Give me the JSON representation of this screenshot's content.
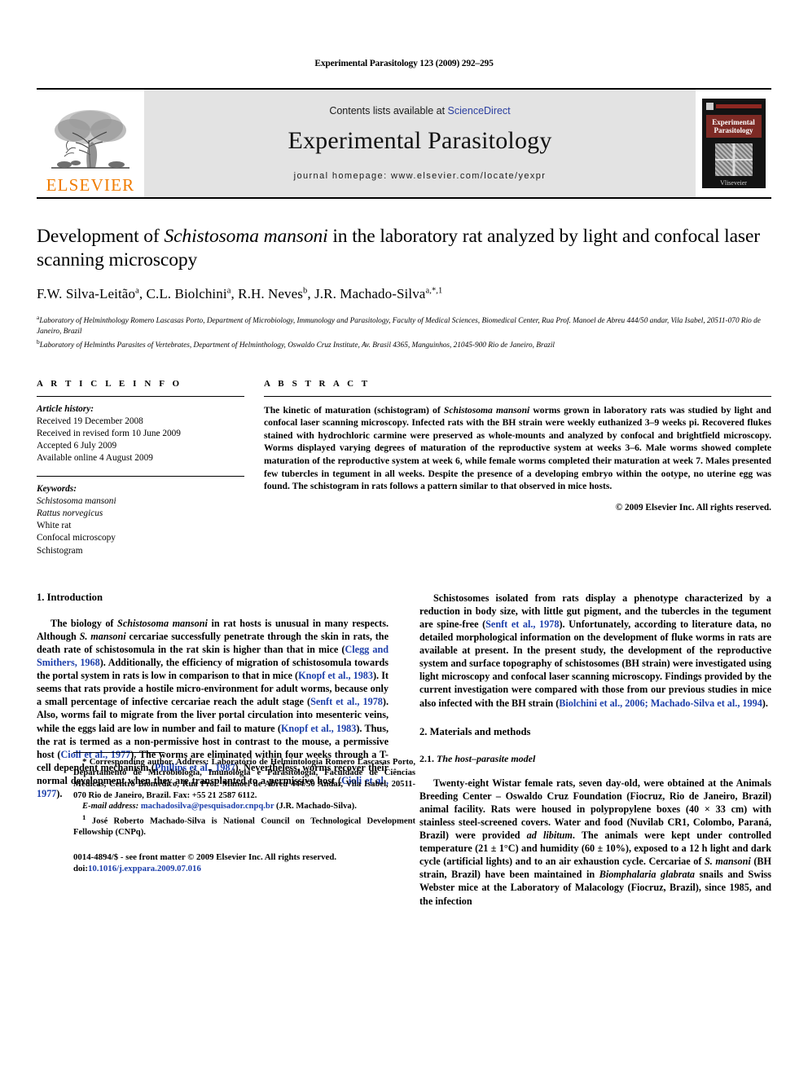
{
  "running_head": "Experimental Parasitology 123 (2009) 292–295",
  "masthead": {
    "elsevier_wordmark": "ELSEVIER",
    "contents_prefix": "Contents lists available at ",
    "sciencedirect": "ScienceDirect",
    "journal_title": "Experimental Parasitology",
    "homepage": "journal homepage: www.elsevier.com/locate/yexpr",
    "cover_title_line1": "Experimental",
    "cover_title_line2": "Parasitology",
    "cover_publisher": "Vliseveier",
    "banner_bg": "#e3e3e3",
    "elsevier_orange": "#F07C00",
    "link_blue": "#2b3fa0"
  },
  "article": {
    "title_part1": "Development of ",
    "title_italic": "Schistosoma mansoni",
    "title_part2": " in the laboratory rat analyzed by light and confocal laser scanning microscopy",
    "authors": "F.W. Silva-Leitão a, C.L. Biolchini a, R.H. Neves b, J.R. Machado-Silva a,*,1",
    "authors_parts": [
      {
        "name": "F.W. Silva-Leitão",
        "sup": "a"
      },
      {
        "name": "C.L. Biolchini",
        "sup": "a"
      },
      {
        "name": "R.H. Neves",
        "sup": "b"
      },
      {
        "name": "J.R. Machado-Silva",
        "sup": "a,*,1"
      }
    ],
    "affiliation_a": "Laboratory of Helminthology Romero Lascasas Porto, Department of Microbiology, Immunology and Parasitology, Faculty of Medical Sciences, Biomedical Center, Rua Prof. Manoel de Abreu 444/50 andar, Vila Isabel, 20511-070 Rio de Janeiro, Brazil",
    "affiliation_b": "Laboratory of Helminths Parasites of Vertebrates, Department of Helminthology, Oswaldo Cruz Institute, Av. Brasil 4365, Manguinhos, 21045-900 Rio de Janeiro, Brazil",
    "affiliation_a_sup": "a",
    "affiliation_b_sup": "b"
  },
  "article_info": {
    "heading": "A R T I C L E  I N F O",
    "history_label": "Article history:",
    "history": [
      "Received 19 December 2008",
      "Received in revised form 10 June 2009",
      "Accepted 6 July 2009",
      "Available online 4 August 2009"
    ],
    "keywords_label": "Keywords:",
    "keywords": [
      "Schistosoma mansoni",
      "Rattus norvegicus",
      "White rat",
      "Confocal microscopy",
      "Schistogram"
    ],
    "keywords_italic_count": 2
  },
  "abstract": {
    "heading": "A B S T R A C T",
    "text_1": "The kinetic of maturation (schistogram) of ",
    "text_italic_1": "Schistosoma mansoni",
    "text_2": " worms grown in laboratory rats was studied by light and confocal laser scanning microscopy. Infected rats with the BH strain were weekly euthanized 3–9 weeks pi. Recovered flukes stained with hydrochloric carmine were preserved as whole-mounts and analyzed by confocal and brightfield microscopy. Worms displayed varying degrees of maturation of the reproductive system at weeks 3–6. Male worms showed complete maturation of the reproductive system at week 6, while female worms completed their maturation at week 7. Males presented few tubercles in tegument in all weeks. Despite the presence of a developing embryo within the ootype, no uterine egg was found. The schistogram in rats follows a pattern similar to that observed in mice hosts.",
    "copyright": "© 2009 Elsevier Inc. All rights reserved."
  },
  "sections": {
    "introduction_heading": "1. Introduction",
    "materials_heading": "2. Materials and methods",
    "host_parasite_num": "2.1. ",
    "host_parasite_title": "The host–parasite model"
  },
  "body": {
    "intro_p1": {
      "s1": "The biology of ",
      "i1": "Schistosoma mansoni",
      "s2": " in rat hosts is unusual in many respects. Although ",
      "i2": "S. mansoni",
      "s3": " cercariae successfully penetrate through the skin in rats, the death rate of schistosomula in the rat skin is higher than that in mice (",
      "c1": "Clegg and Smithers, 1968",
      "s4": "). Additionally, the efficiency of migration of schistosomula towards the portal system in rats is low in comparison to that in mice (",
      "c2": "Knopf et al., 1983",
      "s5": "). It seems that rats provide a hostile micro-environment for adult worms, because only a small percentage of infective cercariae reach the adult stage (",
      "c3": "Senft et al., 1978",
      "s6": "). Also, worms fail to migrate from the liver portal circulation into mesenteric veins, while the eggs laid are low in number and fail to mature (",
      "c4": "Knopf et al., 1983",
      "s7": "). Thus, the rat is termed as a non-permissive host in contrast to the mouse, a permissive host (",
      "c5": "Cioli et al., 1977",
      "s8": "). The worms are eliminated within four weeks through a T-cell dependent mechanism (",
      "c6": "Phillips et al., 1987",
      "s9": "). Nevertheless, worms recover their normal development when they are transplanted to a permissive host (",
      "c7": "Cioli et al., 1977",
      "s10": ")."
    },
    "intro_p2": {
      "s1": "Schistosomes isolated from rats display a phenotype characterized by a reduction in body size, with little gut pigment, and the tubercles in the tegument are spine-free (",
      "c1": "Senft et al., 1978",
      "s2": "). Unfortunately, according to literature data, no detailed morphological information on the development of fluke worms in rats are available at present. In the present study, the development of the reproductive system and surface topography of schistosomes (BH strain) were investigated using light microscopy and confocal laser scanning microscopy. Findings provided by the current investigation were compared with those from our previous studies in mice also infected with the BH strain (",
      "c2": "Biolchini et al., 2006; Machado-Silva et al., 1994",
      "s3": ")."
    },
    "methods_p1": {
      "s1": "Twenty-eight Wistar female rats, seven day-old, were obtained at the Animals Breeding Center – Oswaldo Cruz Foundation (Fiocruz, Rio de Janeiro, Brazil) animal facility. Rats were housed in polypropylene boxes (40 × 33 cm) with stainless steel-screened covers. Water and food (Nuvilab CR1, Colombo, Paraná, Brazil) were provided ",
      "i1": "ad libitum",
      "s2": ". The animals were kept under controlled temperature (21 ± 1°C) and humidity (60 ± 10%), exposed to a 12 h light and dark cycle (artificial lights) and to an air exhaustion cycle. Cercariae of ",
      "i2": "S. mansoni",
      "s3": " (BH strain, Brazil) have been maintained in ",
      "i3": "Biomphalaria glabrata",
      "s4": " snails and Swiss Webster mice at the Laboratory of Malacology (Fiocruz, Brazil), since 1985, and the infection"
    }
  },
  "footnotes": {
    "corresponding_star": "*",
    "corresponding": " Corresponding author. Address: Laboratório de Helmintologia Romero Lascasas Porto, Departamento de Microbiologia, Imunologia e Parasitologia, Faculdade de Ciências Médicas, Centro Biomédico, Rua Prof. Manoel de Abreu 444/50 Andar, Vila Isabel, 20511-070 Rio de Janeiro, Brazil. Fax: +55 21 2587 6112.",
    "email_label": "E-mail address:",
    "email": "machadosilva@pesquisador.cnpq.br",
    "email_attrib": " (J.R. Machado-Silva).",
    "fellowship_sup": "1",
    "fellowship": " José Roberto Machado-Silva is National Council on Technological Development Fellowship (CNPq)."
  },
  "imprint": {
    "issn_line": "0014-4894/$ - see front matter © 2009 Elsevier Inc. All rights reserved.",
    "doi_label": "doi:",
    "doi_value": "10.1016/j.exppara.2009.07.016"
  }
}
